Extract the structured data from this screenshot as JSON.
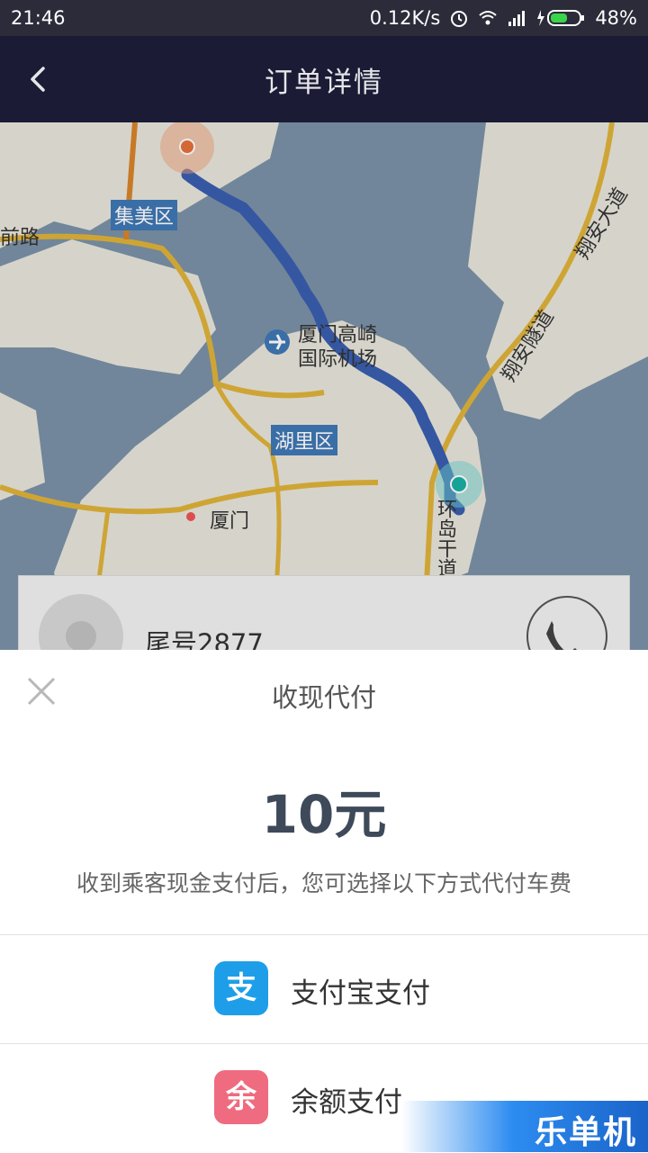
{
  "status_bar": {
    "time": "21:46",
    "network_speed": "0.12K/s",
    "battery": "48%"
  },
  "header": {
    "title": "订单详情"
  },
  "map": {
    "labels": {
      "jimei": "集美区",
      "huli": "湖里区",
      "airport_line1": "厦门高崎",
      "airport_line2": "国际机场",
      "xiamen": "厦门",
      "road_left": "前路",
      "road_xiangan1": "翔安大道",
      "road_xiangan2": "翔安隧道",
      "road_huandao": "环岛干道"
    },
    "colors": {
      "route": "#3a5fb0",
      "water": "#7b92a8",
      "land": "#e9e6dc"
    }
  },
  "driver_card": {
    "phone_tail": "尾号2877"
  },
  "sheet": {
    "title": "收现代付",
    "amount": "10元",
    "hint": "收到乘客现金支付后，您可选择以下方式代付车费",
    "options": [
      {
        "label": "支付宝支付",
        "icon_char": "支",
        "icon_color": "#1e9ee8"
      },
      {
        "label": "余额支付",
        "icon_char": "余",
        "icon_color": "#ef6b7f"
      }
    ]
  },
  "watermark": {
    "text": "乐单机"
  }
}
